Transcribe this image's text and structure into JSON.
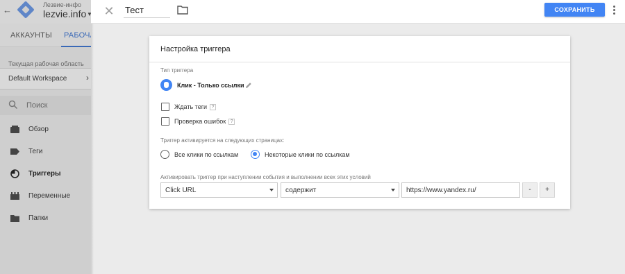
{
  "sidebar": {
    "account_label": "Лезвие-инфо",
    "container_name": "lezvie.info",
    "tabs": [
      {
        "label": "АККАУНТЫ"
      },
      {
        "label": "РАБОЧАЯ"
      }
    ],
    "workspace_label": "Текущая рабочая область",
    "workspace_name": "Default Workspace",
    "search_placeholder": "Поиск",
    "nav": [
      {
        "label": "Обзор",
        "icon": "overview-icon"
      },
      {
        "label": "Теги",
        "icon": "tag-icon"
      },
      {
        "label": "Триггеры",
        "icon": "trigger-icon"
      },
      {
        "label": "Переменные",
        "icon": "variables-icon"
      },
      {
        "label": "Папки",
        "icon": "folder-icon"
      }
    ]
  },
  "topbar": {
    "name_value": "Тест",
    "save_label": "СОХРАНИТЬ"
  },
  "card": {
    "title": "Настройка триггера",
    "trigger_type_label": "Тип триггера",
    "trigger_type_value": "Клик - Только ссылки",
    "checkboxes": [
      {
        "label": "Ждать теги",
        "checked": false
      },
      {
        "label": "Проверка ошибок",
        "checked": false
      }
    ],
    "fires_on_label": "Триггер активируется на следующих страницах:",
    "radios": [
      {
        "label": "Все клики по ссылкам",
        "checked": false
      },
      {
        "label": "Некоторые клики по ссылкам",
        "checked": true
      }
    ],
    "condition_label": "Активировать триггер при наступлении события и выполнении всех этих условий",
    "condition": {
      "variable": "Click URL",
      "operator": "содержит",
      "value": "https://www.yandex.ru/",
      "remove_label": "-",
      "add_label": "+"
    }
  },
  "colors": {
    "accent": "#4285f4",
    "sidebar_bg": "#cfcfcf",
    "page_bg": "#ebebeb",
    "tab_active": "#3a69b7"
  }
}
